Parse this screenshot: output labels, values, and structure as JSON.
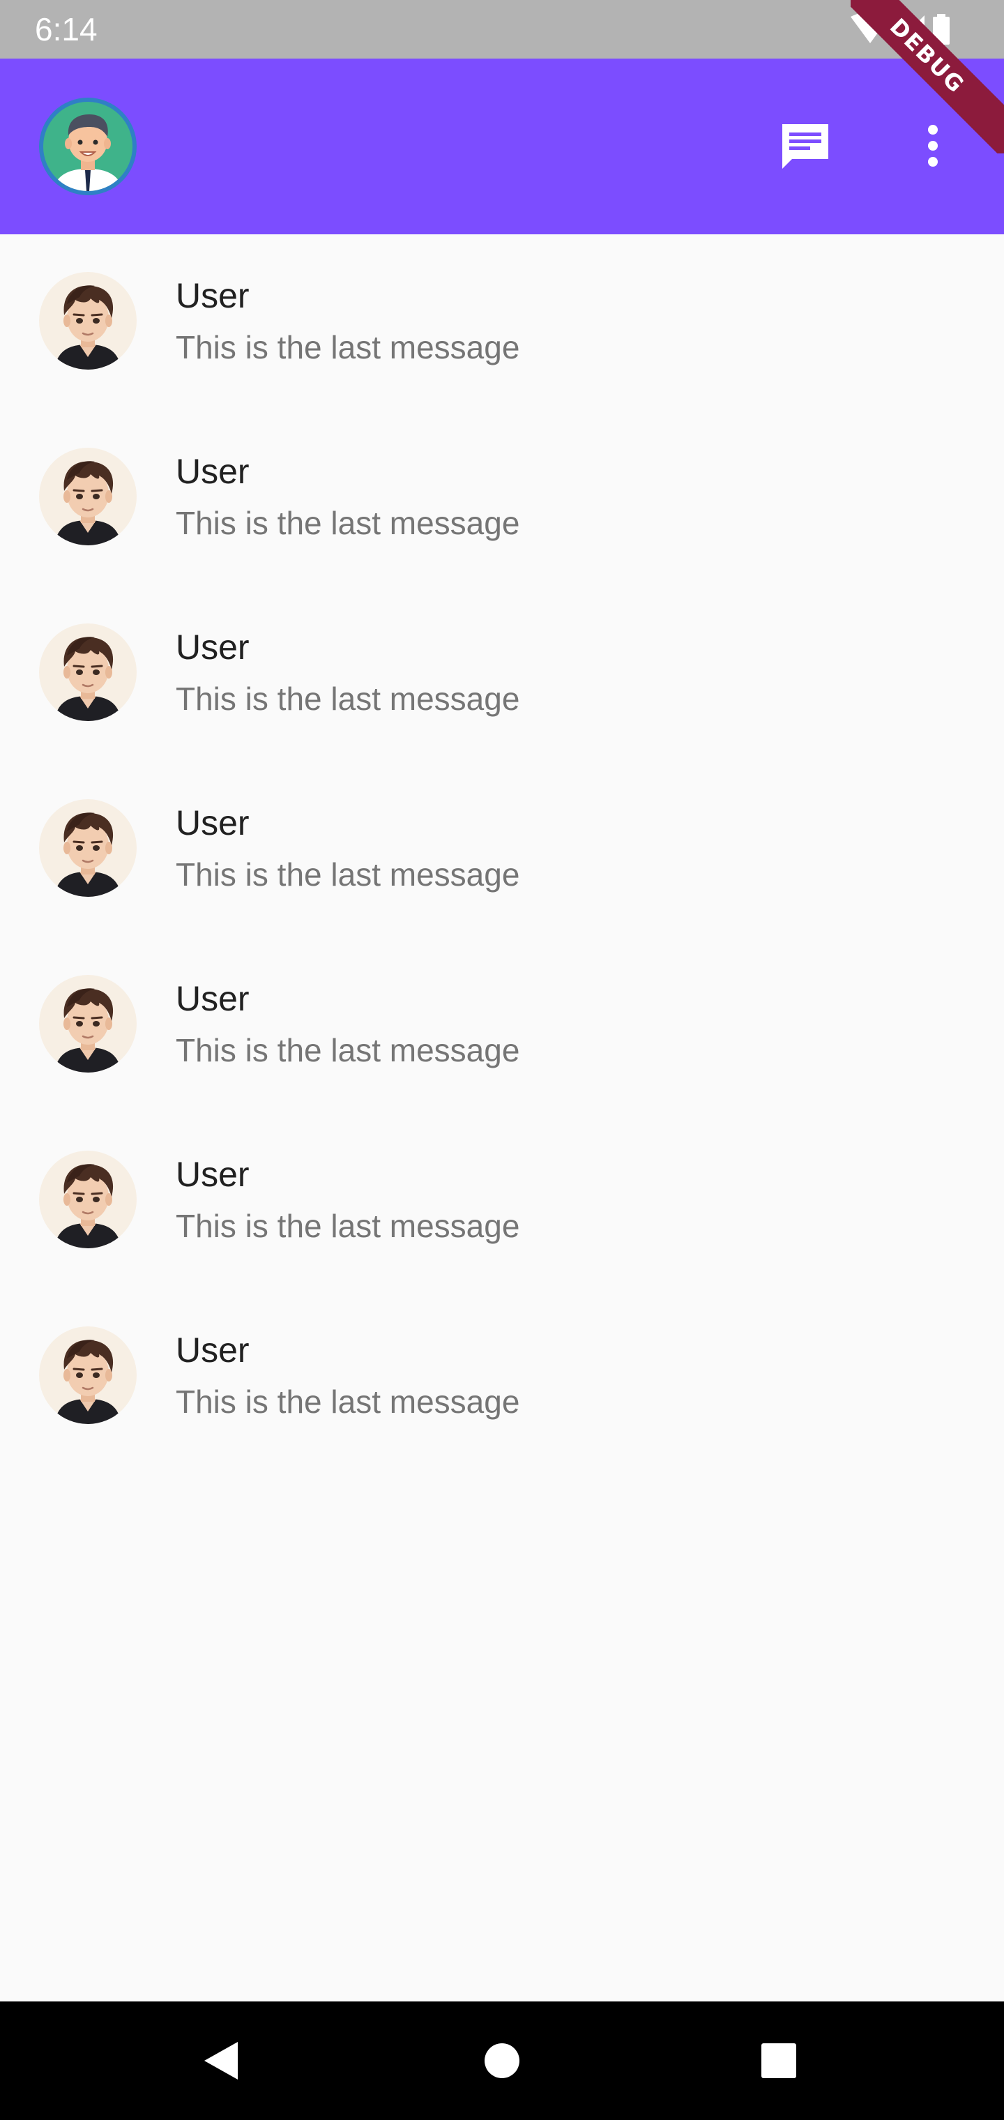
{
  "status_bar": {
    "time": "6:14",
    "icons": [
      "wifi-icon",
      "signal-icon",
      "battery-icon"
    ]
  },
  "app_bar": {
    "background_color": "#7c4dff",
    "actions": [
      "chat-icon",
      "more-vert-icon"
    ]
  },
  "debug_banner": {
    "label": "DEBUG",
    "color": "#8c1b3c"
  },
  "chats": [
    {
      "name": "User",
      "last_message": "This is the last message"
    },
    {
      "name": "User",
      "last_message": "This is the last message"
    },
    {
      "name": "User",
      "last_message": "This is the last message"
    },
    {
      "name": "User",
      "last_message": "This is the last message"
    },
    {
      "name": "User",
      "last_message": "This is the last message"
    },
    {
      "name": "User",
      "last_message": "This is the last message"
    },
    {
      "name": "User",
      "last_message": "This is the last message"
    }
  ],
  "nav_bar": {
    "buttons": [
      "back-icon",
      "home-icon",
      "recents-icon"
    ]
  }
}
